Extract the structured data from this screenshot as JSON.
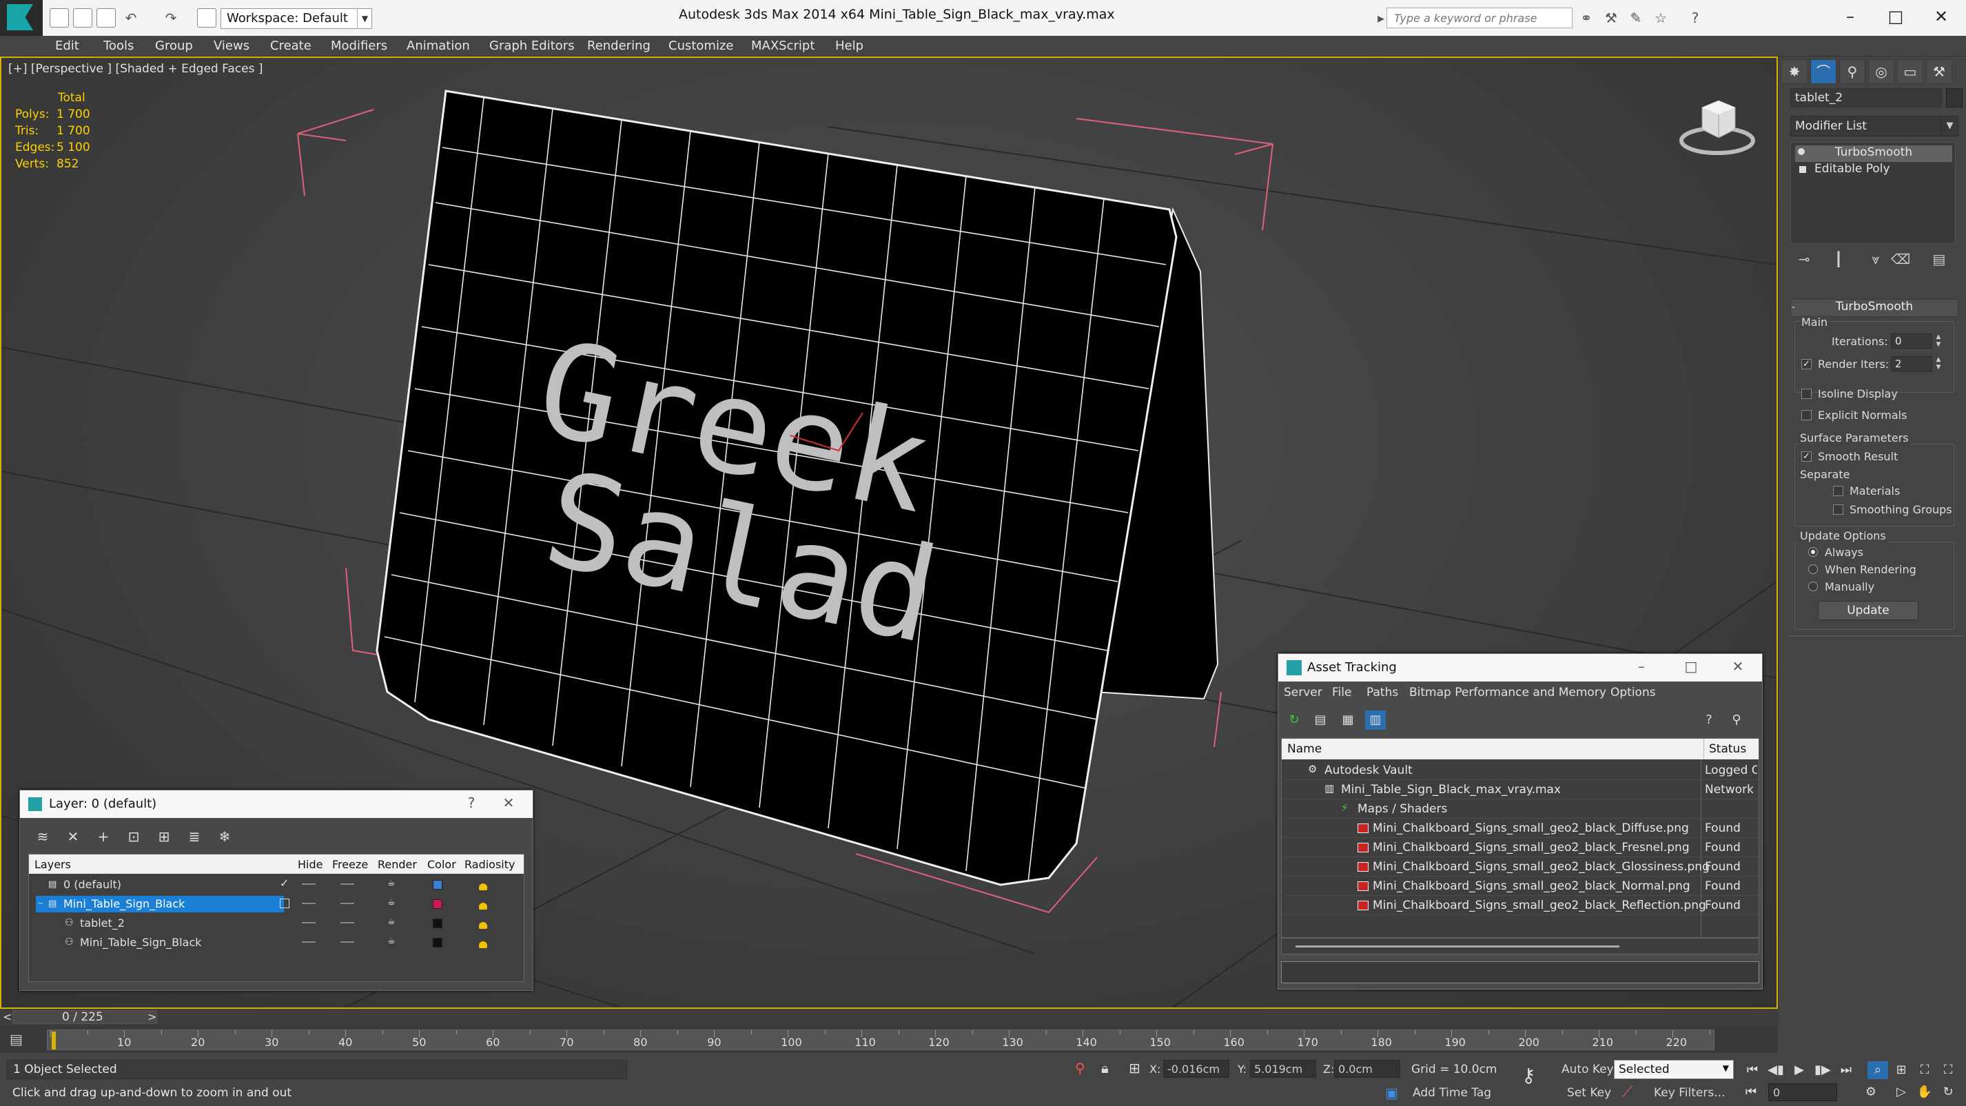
{
  "titlebar": {
    "workspace": "Workspace: Default",
    "title": "Autodesk 3ds Max  2014 x64      Mini_Table_Sign_Black_max_vray.max",
    "search_placeholder": "Type a keyword or phrase"
  },
  "menu": [
    "Edit",
    "Tools",
    "Group",
    "Views",
    "Create",
    "Modifiers",
    "Animation",
    "Graph Editors",
    "Rendering",
    "Customize",
    "MAXScript",
    "Help"
  ],
  "viewport": {
    "label": "[+] [Perspective ] [Shaded + Edged Faces ]",
    "stats_header": "Total",
    "stats": [
      {
        "k": "Polys:",
        "v": "1 700"
      },
      {
        "k": "Tris:",
        "v": "1 700"
      },
      {
        "k": "Edges:",
        "v": "5 100"
      },
      {
        "k": "Verts:",
        "v": "852"
      }
    ],
    "sign_text_1": "Greek",
    "sign_text_2": "Salad"
  },
  "command_panel": {
    "object_name": "tablet_2",
    "modifier_list": "Modifier List",
    "stack": [
      "TurboSmooth",
      "Editable Poly"
    ],
    "rollout": "TurboSmooth",
    "main_label": "Main",
    "iterations_label": "Iterations:",
    "iterations": "0",
    "render_iters_label": "Render Iters:",
    "render_iters": "2",
    "isoline": "Isoline Display",
    "explicit_normals": "Explicit Normals",
    "surface_params": "Surface Parameters",
    "smooth_result": "Smooth Result",
    "separate": "Separate",
    "materials": "Materials",
    "smoothing_groups": "Smoothing Groups",
    "update_options": "Update Options",
    "always": "Always",
    "when_rendering": "When Rendering",
    "manually": "Manually",
    "update": "Update"
  },
  "layer_dialog": {
    "title": "Layer: 0 (default)",
    "columns": [
      "Layers",
      "Hide",
      "Freeze",
      "Render",
      "Color",
      "Radiosity"
    ],
    "rows": [
      {
        "name": "0 (default)",
        "color": "#3a7fd0"
      },
      {
        "name": "Mini_Table_Sign_Black",
        "color": "#c8185a"
      },
      {
        "name": "tablet_2",
        "color": "#111111"
      },
      {
        "name": "Mini_Table_Sign_Black",
        "color": "#111111"
      }
    ]
  },
  "asset_dialog": {
    "title": "Asset Tracking",
    "menu": [
      "Server",
      "File",
      "Paths",
      "Bitmap Performance and Memory",
      "Options"
    ],
    "col_name": "Name",
    "col_status": "Status",
    "rows": [
      {
        "name": "Autodesk Vault",
        "status": "Logged O"
      },
      {
        "name": "Mini_Table_Sign_Black_max_vray.max",
        "status": "Network"
      },
      {
        "name": "Maps / Shaders",
        "status": ""
      },
      {
        "name": "Mini_Chalkboard_Signs_small_geo2_black_Diffuse.png",
        "status": "Found"
      },
      {
        "name": "Mini_Chalkboard_Signs_small_geo2_black_Fresnel.png",
        "status": "Found"
      },
      {
        "name": "Mini_Chalkboard_Signs_small_geo2_black_Glossiness.png",
        "status": "Found"
      },
      {
        "name": "Mini_Chalkboard_Signs_small_geo2_black_Normal.png",
        "status": "Found"
      },
      {
        "name": "Mini_Chalkboard_Signs_small_geo2_black_Reflection.png",
        "status": "Found"
      }
    ]
  },
  "timeline": {
    "frame": "0 / 225",
    "ticks": [
      "10",
      "20",
      "30",
      "40",
      "50",
      "60",
      "70",
      "80",
      "90",
      "100",
      "110",
      "120",
      "130",
      "140",
      "150",
      "160",
      "170",
      "180",
      "190",
      "200",
      "210",
      "220"
    ]
  },
  "status": {
    "selection": "1 Object Selected",
    "prompt": "Click and drag up-and-down to zoom in and out",
    "x_label": "X:",
    "x": "-0.016cm",
    "y_label": "Y:",
    "y": "5.019cm",
    "z_label": "Z:",
    "z": "0.0cm",
    "grid": "Grid = 10.0cm",
    "auto_key": "Auto Key",
    "selected": "Selected",
    "set_key": "Set Key",
    "key_filters": "Key Filters...",
    "add_time_tag": "Add Time Tag",
    "frame_num": "0"
  }
}
